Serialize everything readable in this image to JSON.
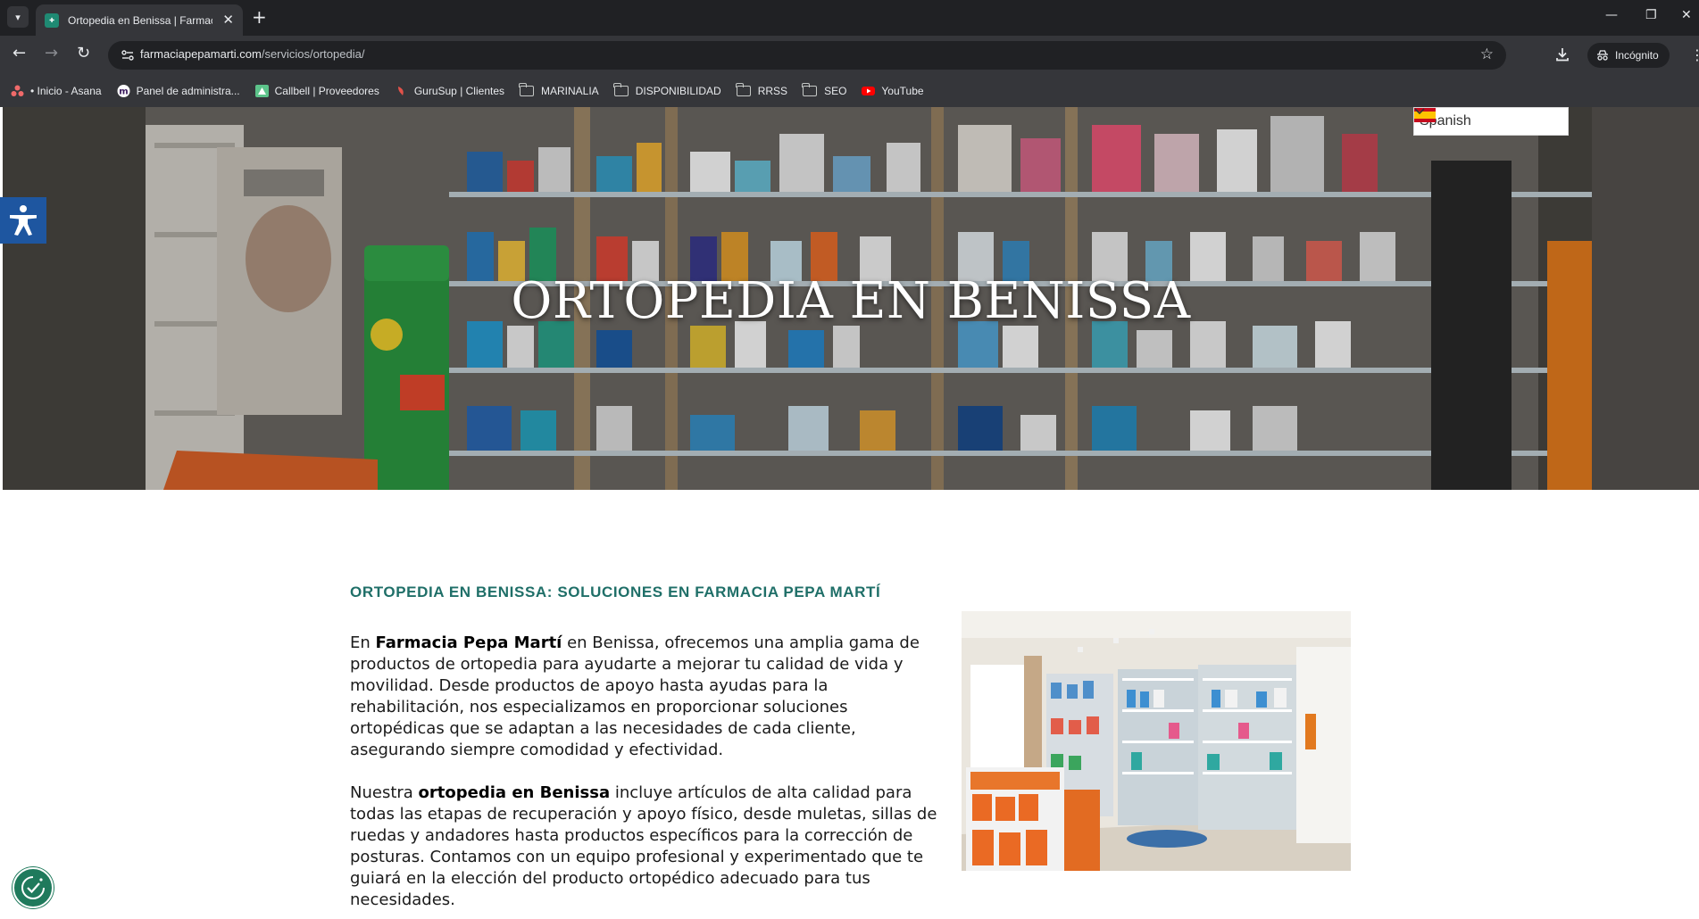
{
  "browser": {
    "tab_title": "Ortopedia en Benissa | Farmacia",
    "url_host": "farmaciapepamarti.com",
    "url_path": "/servicios/ortopedia/",
    "incognito_label": "Incógnito",
    "bookmarks": [
      {
        "label": "• Inicio - Asana",
        "icon": "asana-icon"
      },
      {
        "label": "Panel de administra...",
        "icon": "m-logo-icon"
      },
      {
        "label": "Callbell | Proveedores",
        "icon": "callbell-icon"
      },
      {
        "label": "GuruSup | Clientes",
        "icon": "gurusup-icon"
      },
      {
        "label": "MARINALIA",
        "icon": "folder-icon"
      },
      {
        "label": "DISPONIBILIDAD",
        "icon": "folder-icon"
      },
      {
        "label": "RRSS",
        "icon": "folder-icon"
      },
      {
        "label": "SEO",
        "icon": "folder-icon"
      },
      {
        "label": "YouTube",
        "icon": "youtube-icon"
      }
    ]
  },
  "language_selector": {
    "label": "Spanish",
    "flag": "spain-flag-icon"
  },
  "hero": {
    "title": "ORTOPEDIA EN BENISSA"
  },
  "section": {
    "heading": "ORTOPEDIA EN BENISSA: SOLUCIONES EN FARMACIA PEPA MARTÍ"
  },
  "content": {
    "p1_before": "En ",
    "p1_bold": "Farmacia Pepa Martí",
    "p1_after": " en Benissa, ofrecemos una amplia gama de productos de ortopedia para ayudarte a mejorar tu calidad de vida y movilidad. Desde productos de apoyo hasta ayudas para la rehabilitación, nos especializamos en proporcionar soluciones ortopédicas que se adaptan a las necesidades de cada cliente, asegurando siempre comodidad y efectividad.",
    "p2_before": "Nuestra ",
    "p2_bold": "ortopedia en Benissa",
    "p2_after": " incluye artículos de alta calidad para todas las etapas de recuperación y apoyo físico, desde muletas, sillas de ruedas y andadores hasta productos específicos para la corrección de posturas. Contamos con un equipo profesional y experimentado que te guiará en la elección del producto ortopédico adecuado para tus necesidades."
  },
  "colors": {
    "heading_accent": "#1f6f68",
    "accessibility_blue": "#1e56a0",
    "cookie_green": "#1f7a5c"
  }
}
